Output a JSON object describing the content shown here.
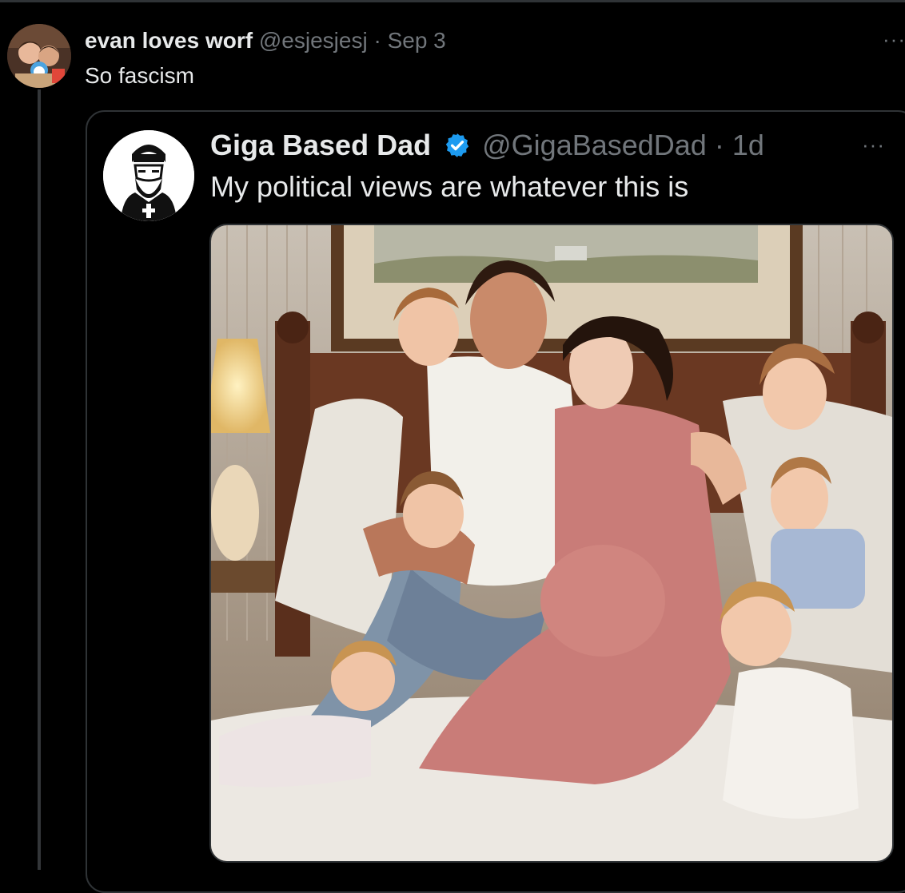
{
  "post": {
    "author_name": "evan loves worf",
    "handle": "@esjesjesj",
    "separator": "·",
    "date": "Sep 3",
    "text": "So fascism",
    "more": "···"
  },
  "quoted": {
    "author_name": "Giga Based Dad",
    "verified": true,
    "handle": "@GigaBasedDad",
    "separator": "·",
    "date": "1d",
    "text": "My political views are whatever this is",
    "more": "···"
  },
  "icons": {
    "verified": "verified-badge-icon",
    "more": "more-options-icon"
  },
  "colors": {
    "background": "#000000",
    "text": "#e7e9ea",
    "muted": "#71767b",
    "border": "#2f3336",
    "verified": "#1d9bf0"
  }
}
